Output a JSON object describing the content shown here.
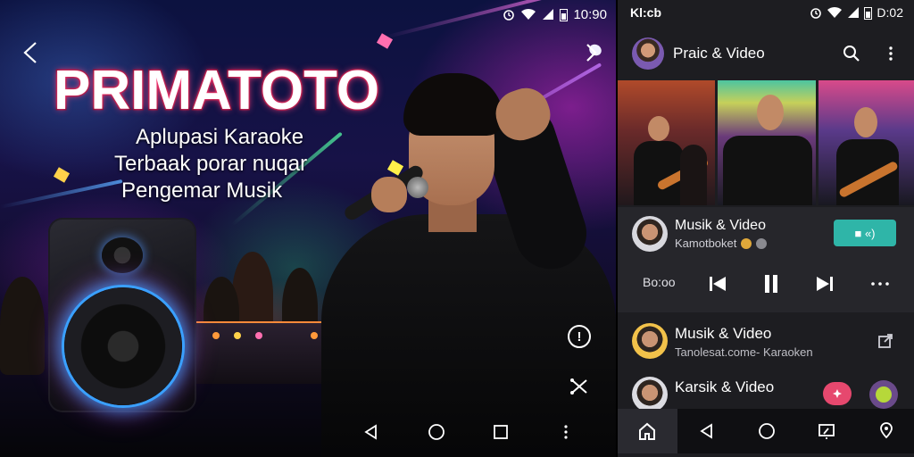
{
  "left": {
    "status": {
      "time": "10:90"
    },
    "promo": {
      "title": "PRIMATOTO",
      "tagline": [
        "Aplupasi Karaoke",
        "Terbaak porar nuqar",
        "Pengemar Musik"
      ]
    },
    "icons": {
      "back": "back-arrow-icon",
      "next": "chevron-right-icon",
      "warning": "exclamation-circle-icon",
      "share": "share-icon"
    },
    "colors": {
      "title_glow": "#ff3c78",
      "speaker_ring": "#3aa0ff"
    }
  },
  "right": {
    "status": {
      "left_text": "Kl:cb",
      "time": "D:02"
    },
    "appbar": {
      "title": "Praic & Video"
    },
    "player": {
      "title": "Musik & Video",
      "subtitle": "Kamotboket",
      "cast_label": "■ «)",
      "time": "Bo:oo"
    },
    "list": [
      {
        "title": "Musik & Video",
        "subtitle": "Tanolesat.come- Karaoken",
        "action_icon": "external-link-icon"
      },
      {
        "title": "Karsik & Video",
        "subtitle": "",
        "action_icon": "play-badge-icon"
      }
    ],
    "colors": {
      "accent": "#2fb5a8",
      "card_bg": "#26262b",
      "bg": "#1d1d21"
    }
  }
}
